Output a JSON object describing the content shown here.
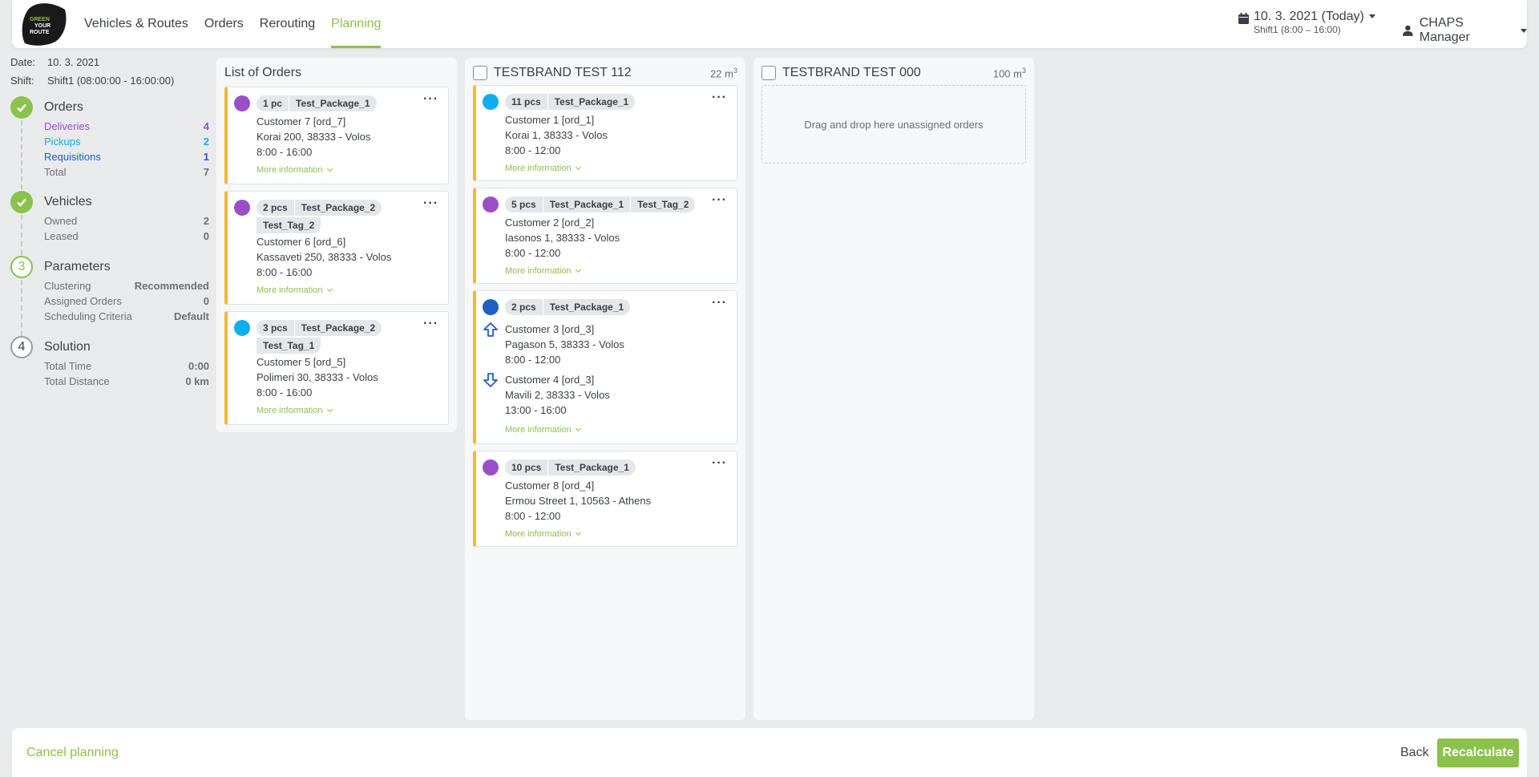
{
  "header": {
    "logo_text": "GREEN YOUR ROUTE",
    "nav": [
      "Vehicles & Routes",
      "Orders",
      "Rerouting",
      "Planning"
    ],
    "active_nav": "Planning",
    "date_main": "10. 3. 2021 (Today)",
    "date_sub": "Shift1 (8:00 – 16:00)",
    "user": "CHAPS Manager"
  },
  "summary": {
    "date_label": "Date:",
    "date_value": "10. 3. 2021",
    "shift_label": "Shift:",
    "shift_value": "Shift1 (08:00:00 - 16:00:00)",
    "orders": {
      "title": "Orders",
      "rows": [
        {
          "label": "Deliveries",
          "value": "4",
          "color": "#9a4fc9"
        },
        {
          "label": "Pickups",
          "value": "2",
          "color": "#0eaff0"
        },
        {
          "label": "Requisitions",
          "value": "1",
          "color": "#1f5fc4"
        },
        {
          "label": "Total",
          "value": "7",
          "color": "#6b6f75"
        }
      ]
    },
    "vehicles": {
      "title": "Vehicles",
      "rows": [
        {
          "label": "Owned",
          "value": "2"
        },
        {
          "label": "Leased",
          "value": "0"
        }
      ]
    },
    "parameters": {
      "number": "3",
      "title": "Parameters",
      "rows": [
        {
          "label": "Clustering",
          "value": "Recommended"
        },
        {
          "label": "Assigned Orders",
          "value": "0"
        },
        {
          "label": "Scheduling Criteria",
          "value": "Default"
        }
      ]
    },
    "solution": {
      "number": "4",
      "title": "Solution",
      "rows": [
        {
          "label": "Total Time",
          "value": "0:00"
        },
        {
          "label": "Total Distance",
          "value": "0 km"
        }
      ]
    }
  },
  "list_of_orders": {
    "title": "List of Orders",
    "more_label": "More information",
    "cards": [
      {
        "tags": [
          "1 pc",
          "Test_Package_1"
        ],
        "customer": "Customer 7 [ord_7]",
        "address": "Korai 200, 38333 - Volos",
        "time": "8:00 - 16:00"
      },
      {
        "tags": [
          "2 pcs",
          "Test_Package_2"
        ],
        "tag2": "Test_Tag_2",
        "customer": "Customer 6 [ord_6]",
        "address": "Kassaveti 250, 38333 - Volos",
        "time": "8:00 - 16:00"
      },
      {
        "tags": [
          "3 pcs",
          "Test_Package_2"
        ],
        "tag2": "Test_Tag_1",
        "customer": "Customer 5 [ord_5]",
        "address": "Polimeri 30, 38333 - Volos",
        "time": "8:00 - 16:00"
      }
    ]
  },
  "vehicle1": {
    "name": "TESTBRAND TEST 112",
    "capacity": "22 m",
    "capacity_unit_sup": "3",
    "more_label": "More information",
    "cards": [
      {
        "tags": [
          "11 pcs",
          "Test_Package_1"
        ],
        "customer": "Customer 1 [ord_1]",
        "address": "Korai 1, 38333 - Volos",
        "time": "8:00 - 12:00"
      },
      {
        "tags": [
          "5 pcs",
          "Test_Package_1",
          "Test_Tag_2"
        ],
        "customer": "Customer 2 [ord_2]",
        "address": "Iasonos 1, 38333 - Volos",
        "time": "8:00 - 12:00"
      },
      {
        "tags": [
          "2 pcs",
          "Test_Package_1"
        ],
        "pickup_customer": "Customer 3 [ord_3]",
        "pickup_address": "Pagason 5, 38333 - Volos",
        "pickup_time": "8:00 - 12:00",
        "drop_customer": "Customer 4 [ord_3]",
        "drop_address": "Mavili 2, 38333 - Volos",
        "drop_time": "13:00 - 16:00"
      },
      {
        "tags": [
          "10 pcs",
          "Test_Package_1"
        ],
        "customer": "Customer 8 [ord_4]",
        "address": "Ermou Street 1, 10563 - Athens",
        "time": "8:00 - 12:00"
      }
    ]
  },
  "vehicle2": {
    "name": "TESTBRAND TEST 000",
    "capacity": "100 m",
    "capacity_unit_sup": "3",
    "dropzone": "Drag and drop here unassigned orders"
  },
  "footer": {
    "cancel": "Cancel planning",
    "back": "Back",
    "recalculate": "Recalculate"
  },
  "colors": {
    "accent": "#8cc14c",
    "card_border": "#f5b82e",
    "delivery": "#9a4fc9",
    "pickup": "#0eaff0",
    "requisition": "#1f5fc4"
  }
}
